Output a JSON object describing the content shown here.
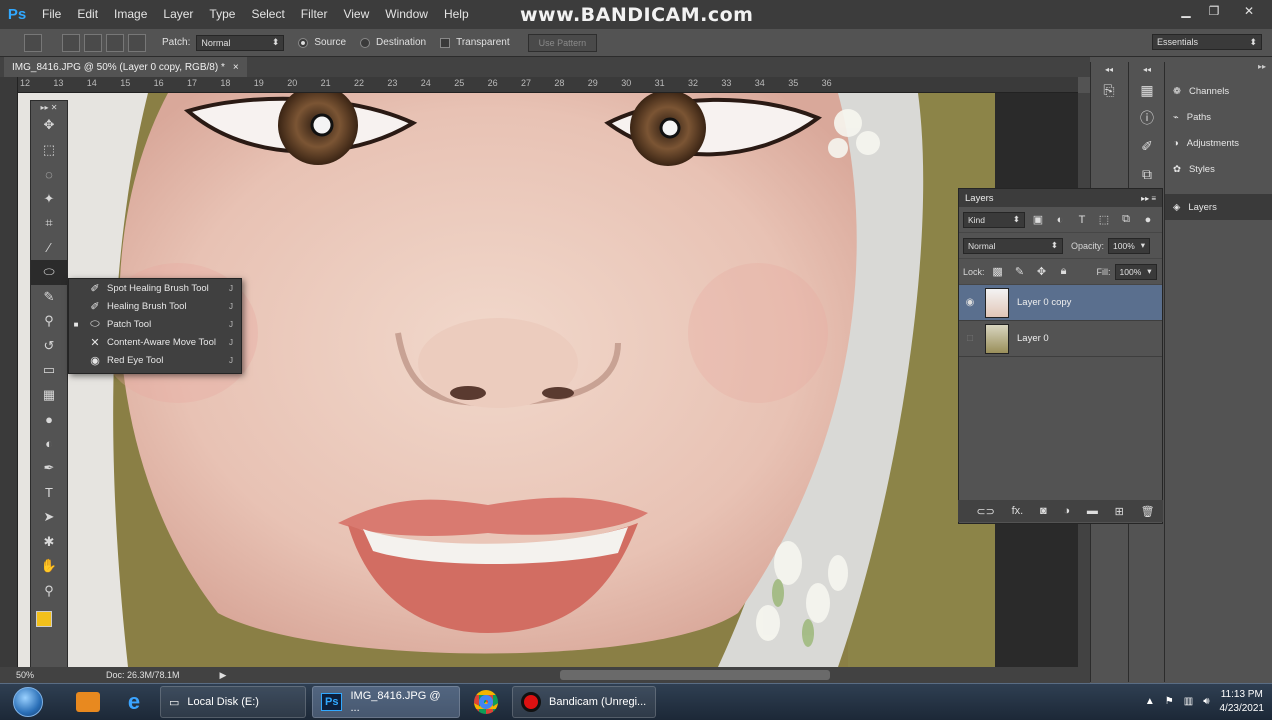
{
  "app": {
    "logo": "Ps",
    "menu": [
      "File",
      "Edit",
      "Image",
      "Layer",
      "Type",
      "Select",
      "Filter",
      "View",
      "Window",
      "Help"
    ],
    "watermark": "www.BANDICAM.com"
  },
  "options_bar": {
    "patch_label": "Patch:",
    "patch_mode": "Normal",
    "source_label": "Source",
    "destination_label": "Destination",
    "transparent_label": "Transparent",
    "use_pattern_label": "Use Pattern",
    "workspace": "Essentials"
  },
  "document": {
    "tab_title": "IMG_8416.JPG @ 50% (Layer 0 copy, RGB/8) *",
    "close_glyph": "×",
    "zoom": "50%",
    "doc_size": "Doc: 26.3M/78.1M",
    "ruler_numbers": [
      "12",
      "13",
      "14",
      "15",
      "16",
      "17",
      "18",
      "19",
      "20",
      "21",
      "22",
      "23",
      "24",
      "25",
      "26",
      "27",
      "28",
      "29",
      "30",
      "31",
      "32",
      "33",
      "34",
      "35",
      "36"
    ]
  },
  "tools_flyout": {
    "items": [
      {
        "label": "Spot Healing Brush Tool",
        "shortcut": "J",
        "icon": "spot-healing-icon",
        "active": false
      },
      {
        "label": "Healing Brush Tool",
        "shortcut": "J",
        "icon": "healing-brush-icon",
        "active": false
      },
      {
        "label": "Patch Tool",
        "shortcut": "J",
        "icon": "patch-icon",
        "active": true
      },
      {
        "label": "Content-Aware Move Tool",
        "shortcut": "J",
        "icon": "content-aware-move-icon",
        "active": false
      },
      {
        "label": "Red Eye Tool",
        "shortcut": "J",
        "icon": "red-eye-icon",
        "active": false
      }
    ]
  },
  "dock": {
    "items": [
      "Channels",
      "Paths",
      "Adjustments",
      "Styles",
      "Layers"
    ]
  },
  "layers_panel": {
    "title": "Layers",
    "kind_filter": "Kind",
    "blend_mode": "Normal",
    "opacity_label": "Opacity:",
    "opacity_value": "100%",
    "lock_label": "Lock:",
    "fill_label": "Fill:",
    "fill_value": "100%",
    "layers": [
      {
        "name": "Layer 0 copy",
        "visible": true,
        "selected": true
      },
      {
        "name": "Layer 0",
        "visible": false,
        "selected": false
      }
    ],
    "footer_fx": "fx."
  },
  "taskbar": {
    "tasks": [
      {
        "label": "Local Disk (E:)",
        "icon": "drive-icon",
        "active": false
      },
      {
        "label": "IMG_8416.JPG @ ...",
        "icon": "photoshop-icon",
        "active": true
      },
      {
        "label": "Bandicam (Unregi...",
        "icon": "bandicam-icon",
        "active": false
      }
    ],
    "time": "11:13 PM",
    "date": "4/23/2021"
  },
  "colors": {
    "foreground_swatch": "#f2c01b",
    "background_swatch": "#000000",
    "selection": "#5a6f8e",
    "photoshop_blue": "#31a8ff"
  }
}
